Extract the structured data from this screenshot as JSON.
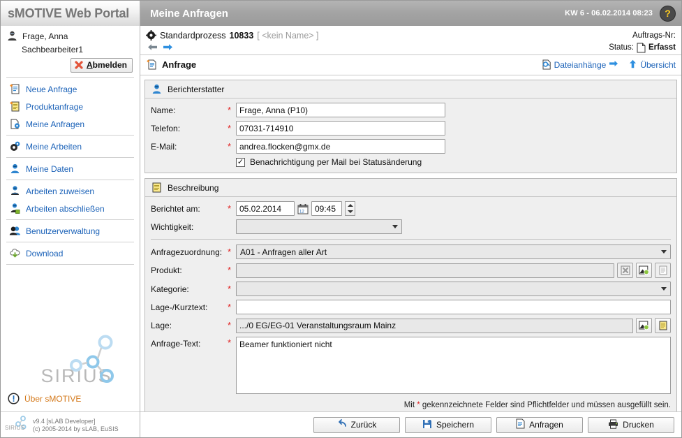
{
  "topbar": {
    "brand": "sMOTIVE Web Portal",
    "page_title": "Meine Anfragen",
    "clock": "KW 6 - 06.02.2014 08:23",
    "help_label": "?"
  },
  "sidebar": {
    "user_name": "Frage, Anna",
    "user_role": "Sachbearbeiter1",
    "logout_label_first": "A",
    "logout_label_rest": "bmelden",
    "items": [
      {
        "label": "Neue Anfrage",
        "icon": "new-request-icon"
      },
      {
        "label": "Produktanfrage",
        "icon": "product-request-icon"
      },
      {
        "label": "Meine Anfragen",
        "icon": "my-requests-icon"
      },
      {
        "label": "Meine Arbeiten",
        "icon": "gears-icon"
      },
      {
        "label": "Meine Daten",
        "icon": "user-data-icon"
      },
      {
        "label": "Arbeiten zuweisen",
        "icon": "assign-work-icon"
      },
      {
        "label": "Arbeiten abschließen",
        "icon": "complete-work-icon"
      },
      {
        "label": "Benutzerverwaltung",
        "icon": "users-icon"
      },
      {
        "label": "Download",
        "icon": "download-cloud-icon"
      }
    ],
    "logo_text": "SIRIUS",
    "about_label": "Über sMOTIVE",
    "version_line1": "v9.4 [sLAB Developer]",
    "version_line2": "(c) 2005-2014 by sLAB, EuSIS",
    "footer_logo_text": "SIRIUS"
  },
  "process": {
    "type_label": "Standardprozess",
    "number": "10833",
    "name_placeholder": "[ <kein Name> ]",
    "order_no_label": "Auftrags-Nr:",
    "status_label": "Status:",
    "status_value": "Erfasst"
  },
  "section": {
    "title": "Anfrage",
    "attachments_label": "Dateianhänge",
    "overview_label": "Übersicht"
  },
  "reporter": {
    "panel_title": "Berichterstatter",
    "name_label": "Name:",
    "name_value": "Frage, Anna (P10)",
    "phone_label": "Telefon:",
    "phone_value": "07031-714910",
    "email_label": "E-Mail:",
    "email_value": "andrea.flocken@gmx.de",
    "notify_checked": true,
    "notify_label": "Benachrichtigung per Mail bei Statusänderung"
  },
  "description": {
    "panel_title": "Beschreibung",
    "reported_label": "Berichtet am:",
    "reported_date": "05.02.2014",
    "reported_time": "09:45",
    "importance_label": "Wichtigkeit:",
    "importance_value": "",
    "assignment_label": "Anfragezuordnung:",
    "assignment_value": "A01 - Anfragen aller Art",
    "product_label": "Produkt:",
    "product_value": "",
    "category_label": "Kategorie:",
    "category_value": "",
    "shorttext_label": "Lage-/Kurztext:",
    "shorttext_value": "",
    "location_label": "Lage:",
    "location_value": ".../0 EG/EG-01 Veranstaltungsraum Mainz",
    "request_text_label": "Anfrage-Text:",
    "request_text_value": "Beamer funktioniert nicht",
    "mandatory_hint_pre": "Mit ",
    "mandatory_hint_star": "*",
    "mandatory_hint_post": " gekennzeichnete Felder sind Pflichtfelder und müssen ausgefüllt sein."
  },
  "footer_buttons": [
    {
      "label": "Zurück",
      "icon": "back-arrow-icon"
    },
    {
      "label": "Speichern",
      "icon": "save-disk-icon"
    },
    {
      "label": "Anfragen",
      "icon": "document-icon"
    },
    {
      "label": "Drucken",
      "icon": "printer-icon"
    }
  ],
  "colors": {
    "link": "#1b62b8",
    "required": "#e02020",
    "accent_orange": "#d4791b",
    "panel_bg": "#efefef",
    "header_gray": "#a3a3a3"
  }
}
